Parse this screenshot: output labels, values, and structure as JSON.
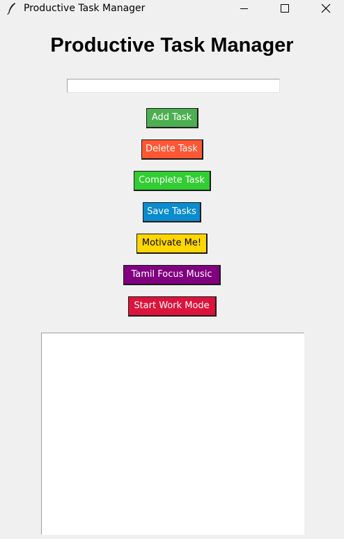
{
  "window": {
    "title": "Productive Task Manager",
    "icon": "feather-icon",
    "controls": [
      "minimize-icon",
      "maximize-icon",
      "close-icon"
    ]
  },
  "main": {
    "heading": "Productive Task Manager",
    "task_input": {
      "value": "",
      "placeholder": ""
    },
    "buttons": [
      {
        "label": "Add Task",
        "bg": "#4caf50",
        "fg": "#ffffff"
      },
      {
        "label": "Delete Task",
        "bg": "#ff5733",
        "fg": "#ffffff"
      },
      {
        "label": "Complete Task",
        "bg": "#32cd32",
        "fg": "#ffffff"
      },
      {
        "label": "Save Tasks",
        "bg": "#0a8ccf",
        "fg": "#ffffff"
      },
      {
        "label": "Motivate Me!",
        "bg": "#ffd700",
        "fg": "#000000"
      },
      {
        "label": "Tamil Focus Music",
        "bg": "#800080",
        "fg": "#ffffff"
      },
      {
        "label": "Start Work Mode",
        "bg": "#dc143c",
        "fg": "#ffffff"
      }
    ],
    "task_list": {
      "items": []
    }
  }
}
